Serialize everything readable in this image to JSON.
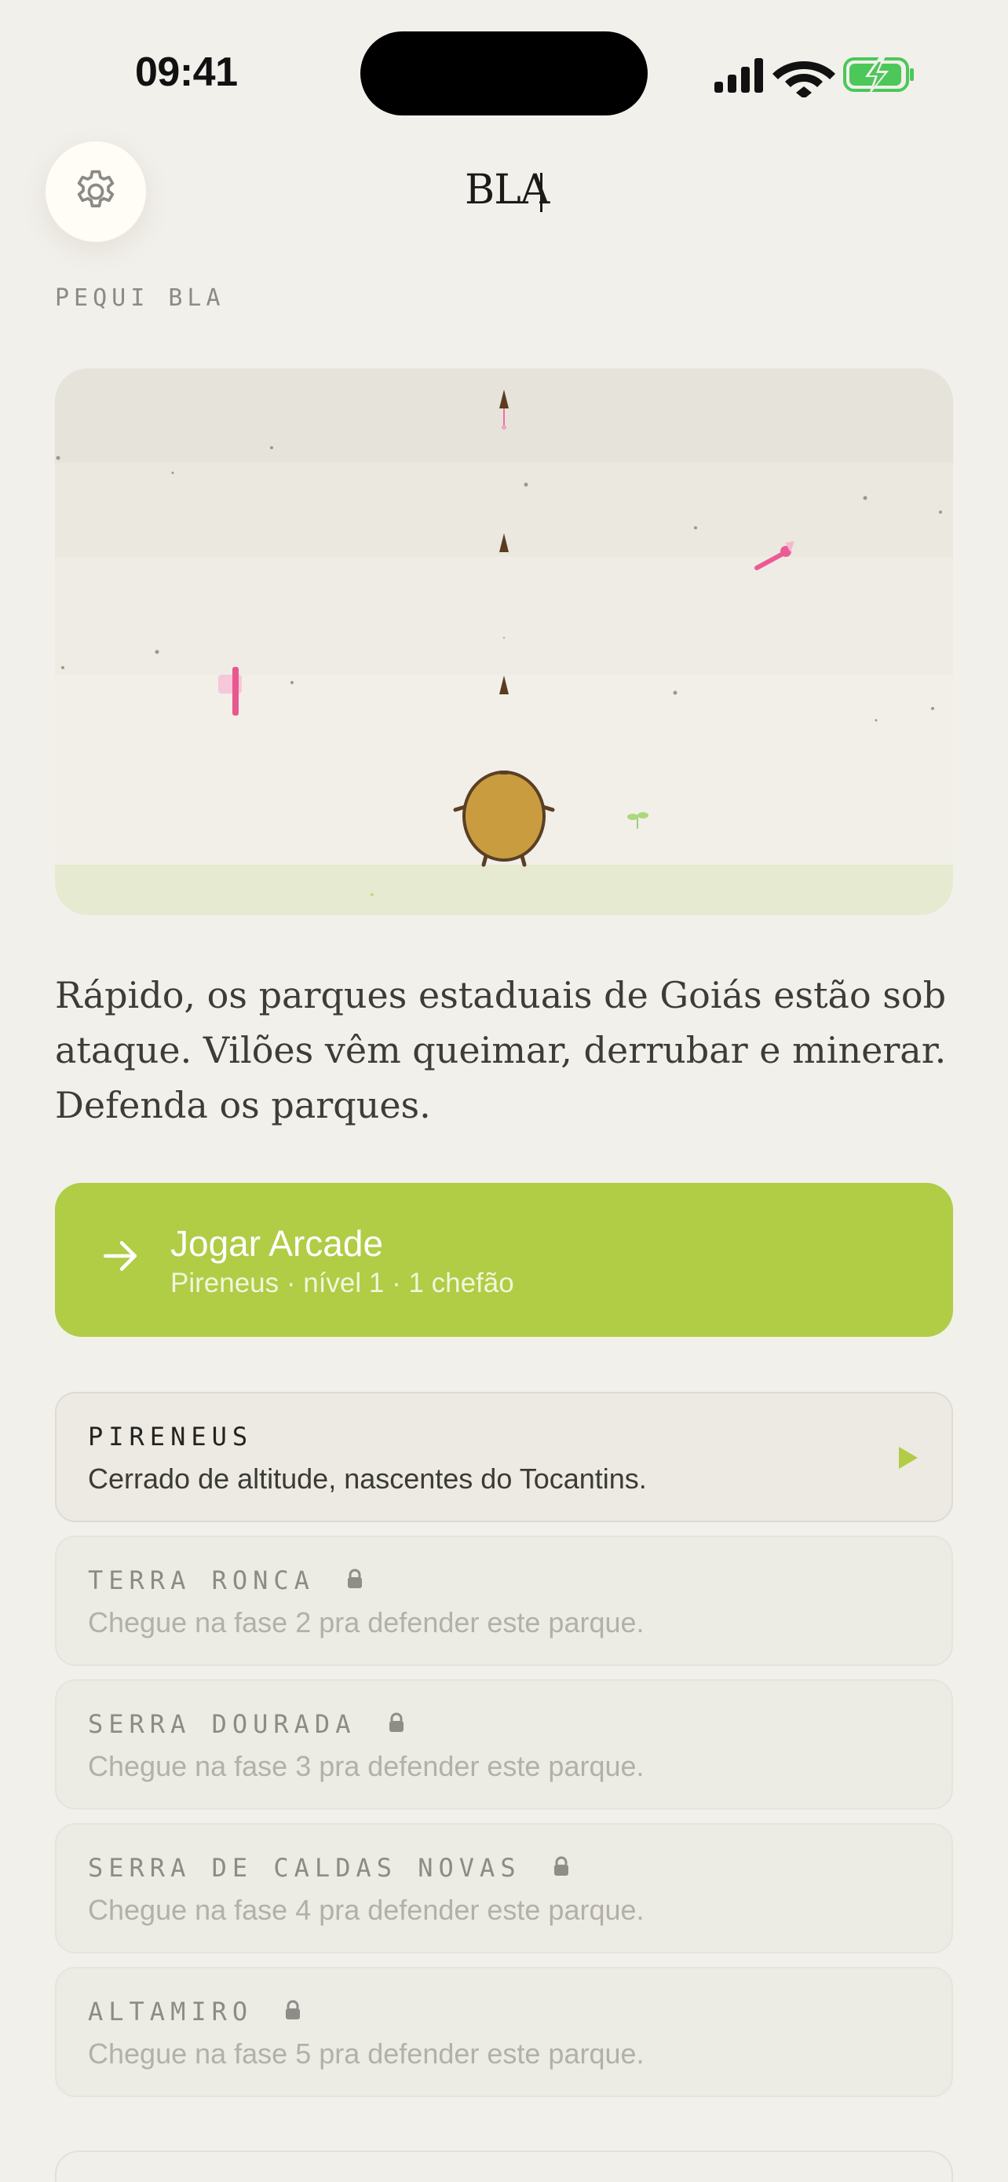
{
  "status_bar": {
    "time": "09:41"
  },
  "header": {
    "logo": "BLA",
    "section_label": "PEQUI BLA"
  },
  "intro_text": "Rápido, os parques estaduais de Goiás estão sob ataque. Vilões vêm queimar, derrubar e minerar. Defenda os parques.",
  "play_button": {
    "title": "Jogar Arcade",
    "subtitle": "Pireneus · nível 1 · 1 chefão",
    "color": "#b1cc45"
  },
  "parks": [
    {
      "name": "PIRENEUS",
      "description": "Cerrado de altitude, nascentes do Tocantins.",
      "locked": false
    },
    {
      "name": "TERRA RONCA",
      "description": "Chegue na fase 2 pra defender este parque.",
      "locked": true
    },
    {
      "name": "SERRA DOURADA",
      "description": "Chegue na fase 3 pra defender este parque.",
      "locked": true
    },
    {
      "name": "SERRA DE CALDAS NOVAS",
      "description": "Chegue na fase 4 pra defender este parque.",
      "locked": true
    },
    {
      "name": "ALTAMIRO",
      "description": "Chegue na fase 5 pra defender este parque.",
      "locked": true
    }
  ],
  "icons": {
    "settings": "gear-icon",
    "play_arrow": "arrow-right-icon",
    "park_play": "play-triangle-icon",
    "lock": "lock-icon",
    "signal": "cellular-signal-icon",
    "wifi": "wifi-icon",
    "battery": "battery-charging-icon"
  },
  "colors": {
    "background": "#f2f0eb",
    "accent": "#b1cc45",
    "player": "#c99c3f",
    "battery": "#4cc759"
  }
}
